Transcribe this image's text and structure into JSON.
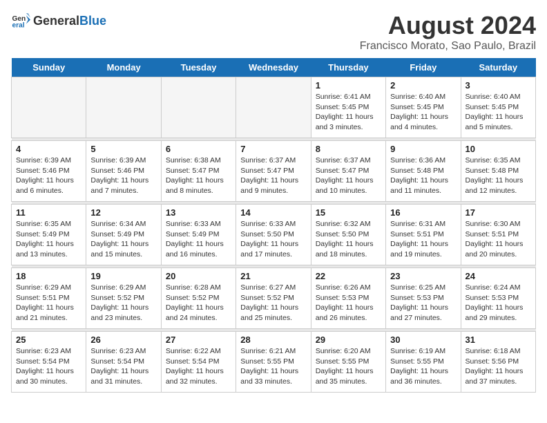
{
  "header": {
    "logo_general": "General",
    "logo_blue": "Blue",
    "title": "August 2024",
    "subtitle": "Francisco Morato, Sao Paulo, Brazil"
  },
  "days_of_week": [
    "Sunday",
    "Monday",
    "Tuesday",
    "Wednesday",
    "Thursday",
    "Friday",
    "Saturday"
  ],
  "weeks": [
    [
      {
        "date": "",
        "empty": true
      },
      {
        "date": "",
        "empty": true
      },
      {
        "date": "",
        "empty": true
      },
      {
        "date": "",
        "empty": true
      },
      {
        "date": "1",
        "sunrise": "6:41 AM",
        "sunset": "5:45 PM",
        "daylight": "11 hours and 3 minutes."
      },
      {
        "date": "2",
        "sunrise": "6:40 AM",
        "sunset": "5:45 PM",
        "daylight": "11 hours and 4 minutes."
      },
      {
        "date": "3",
        "sunrise": "6:40 AM",
        "sunset": "5:45 PM",
        "daylight": "11 hours and 5 minutes."
      }
    ],
    [
      {
        "date": "4",
        "sunrise": "6:39 AM",
        "sunset": "5:46 PM",
        "daylight": "11 hours and 6 minutes."
      },
      {
        "date": "5",
        "sunrise": "6:39 AM",
        "sunset": "5:46 PM",
        "daylight": "11 hours and 7 minutes."
      },
      {
        "date": "6",
        "sunrise": "6:38 AM",
        "sunset": "5:47 PM",
        "daylight": "11 hours and 8 minutes."
      },
      {
        "date": "7",
        "sunrise": "6:37 AM",
        "sunset": "5:47 PM",
        "daylight": "11 hours and 9 minutes."
      },
      {
        "date": "8",
        "sunrise": "6:37 AM",
        "sunset": "5:47 PM",
        "daylight": "11 hours and 10 minutes."
      },
      {
        "date": "9",
        "sunrise": "6:36 AM",
        "sunset": "5:48 PM",
        "daylight": "11 hours and 11 minutes."
      },
      {
        "date": "10",
        "sunrise": "6:35 AM",
        "sunset": "5:48 PM",
        "daylight": "11 hours and 12 minutes."
      }
    ],
    [
      {
        "date": "11",
        "sunrise": "6:35 AM",
        "sunset": "5:49 PM",
        "daylight": "11 hours and 13 minutes."
      },
      {
        "date": "12",
        "sunrise": "6:34 AM",
        "sunset": "5:49 PM",
        "daylight": "11 hours and 15 minutes."
      },
      {
        "date": "13",
        "sunrise": "6:33 AM",
        "sunset": "5:49 PM",
        "daylight": "11 hours and 16 minutes."
      },
      {
        "date": "14",
        "sunrise": "6:33 AM",
        "sunset": "5:50 PM",
        "daylight": "11 hours and 17 minutes."
      },
      {
        "date": "15",
        "sunrise": "6:32 AM",
        "sunset": "5:50 PM",
        "daylight": "11 hours and 18 minutes."
      },
      {
        "date": "16",
        "sunrise": "6:31 AM",
        "sunset": "5:51 PM",
        "daylight": "11 hours and 19 minutes."
      },
      {
        "date": "17",
        "sunrise": "6:30 AM",
        "sunset": "5:51 PM",
        "daylight": "11 hours and 20 minutes."
      }
    ],
    [
      {
        "date": "18",
        "sunrise": "6:29 AM",
        "sunset": "5:51 PM",
        "daylight": "11 hours and 21 minutes."
      },
      {
        "date": "19",
        "sunrise": "6:29 AM",
        "sunset": "5:52 PM",
        "daylight": "11 hours and 23 minutes."
      },
      {
        "date": "20",
        "sunrise": "6:28 AM",
        "sunset": "5:52 PM",
        "daylight": "11 hours and 24 minutes."
      },
      {
        "date": "21",
        "sunrise": "6:27 AM",
        "sunset": "5:52 PM",
        "daylight": "11 hours and 25 minutes."
      },
      {
        "date": "22",
        "sunrise": "6:26 AM",
        "sunset": "5:53 PM",
        "daylight": "11 hours and 26 minutes."
      },
      {
        "date": "23",
        "sunrise": "6:25 AM",
        "sunset": "5:53 PM",
        "daylight": "11 hours and 27 minutes."
      },
      {
        "date": "24",
        "sunrise": "6:24 AM",
        "sunset": "5:53 PM",
        "daylight": "11 hours and 29 minutes."
      }
    ],
    [
      {
        "date": "25",
        "sunrise": "6:23 AM",
        "sunset": "5:54 PM",
        "daylight": "11 hours and 30 minutes."
      },
      {
        "date": "26",
        "sunrise": "6:23 AM",
        "sunset": "5:54 PM",
        "daylight": "11 hours and 31 minutes."
      },
      {
        "date": "27",
        "sunrise": "6:22 AM",
        "sunset": "5:54 PM",
        "daylight": "11 hours and 32 minutes."
      },
      {
        "date": "28",
        "sunrise": "6:21 AM",
        "sunset": "5:55 PM",
        "daylight": "11 hours and 33 minutes."
      },
      {
        "date": "29",
        "sunrise": "6:20 AM",
        "sunset": "5:55 PM",
        "daylight": "11 hours and 35 minutes."
      },
      {
        "date": "30",
        "sunrise": "6:19 AM",
        "sunset": "5:55 PM",
        "daylight": "11 hours and 36 minutes."
      },
      {
        "date": "31",
        "sunrise": "6:18 AM",
        "sunset": "5:56 PM",
        "daylight": "11 hours and 37 minutes."
      }
    ]
  ]
}
